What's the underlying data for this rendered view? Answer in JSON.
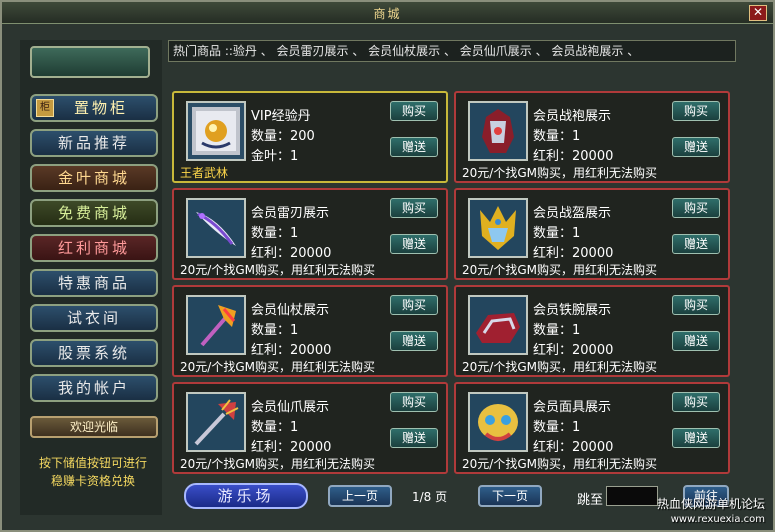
{
  "window": {
    "title": "商城",
    "close_label": "✕"
  },
  "sidebar": {
    "items": [
      {
        "label": "置物柜",
        "icon": "chest-icon",
        "icon_char": "柜"
      },
      {
        "label": "新品推荐"
      },
      {
        "label": "金叶商城"
      },
      {
        "label": "免费商城"
      },
      {
        "label": "红利商城"
      },
      {
        "label": "特惠商品"
      },
      {
        "label": "试衣间"
      },
      {
        "label": "股票系统"
      },
      {
        "label": "我的帐户"
      }
    ],
    "welcome": "欢迎光临",
    "tip_line1": "按下储值按钮可进行",
    "tip_line2": "稳赚卡资格兑换"
  },
  "ticker": {
    "label": "热门商品 :",
    "text": ":验丹 、 会员雷刃展示 、 会员仙杖展示 、 会员仙爪展示 、 会员战袍展示 、"
  },
  "labels": {
    "buy": "购买",
    "gift": "赠送",
    "note": "20元/个找GM购买，用红利无法购买"
  },
  "items": [
    {
      "name": "VIP经验丹",
      "qty": "数量：200",
      "price": "金叶：1",
      "note": "王者武林",
      "icon": "orb-icon"
    },
    {
      "name": "会员战袍展示",
      "qty": "数量：1",
      "price": "红利：20000",
      "icon": "armor-icon"
    },
    {
      "name": "会员雷刃展示",
      "qty": "数量：1",
      "price": "红利：20000",
      "icon": "blade-icon"
    },
    {
      "name": "会员战盔展示",
      "qty": "数量：1",
      "price": "红利：20000",
      "icon": "helmet-icon"
    },
    {
      "name": "会员仙杖展示",
      "qty": "数量：1",
      "price": "红利：20000",
      "icon": "staff-icon"
    },
    {
      "name": "会员铁腕展示",
      "qty": "数量：1",
      "price": "红利：20000",
      "icon": "gauntlet-icon"
    },
    {
      "name": "会员仙爪展示",
      "qty": "数量：1",
      "price": "红利：20000",
      "icon": "claw-icon"
    },
    {
      "name": "会员面具展示",
      "qty": "数量：1",
      "price": "红利：20000",
      "icon": "mask-icon"
    }
  ],
  "footer": {
    "fun_label": "游乐场",
    "prev_label": "上一页",
    "page_info": "1/8 页",
    "next_label": "下一页",
    "jump_label": "跳至",
    "jump_value": "",
    "go_label": "前往"
  },
  "watermark": {
    "line1": "热血侠网游单机论坛",
    "line2": "www.rexuexia.com"
  }
}
